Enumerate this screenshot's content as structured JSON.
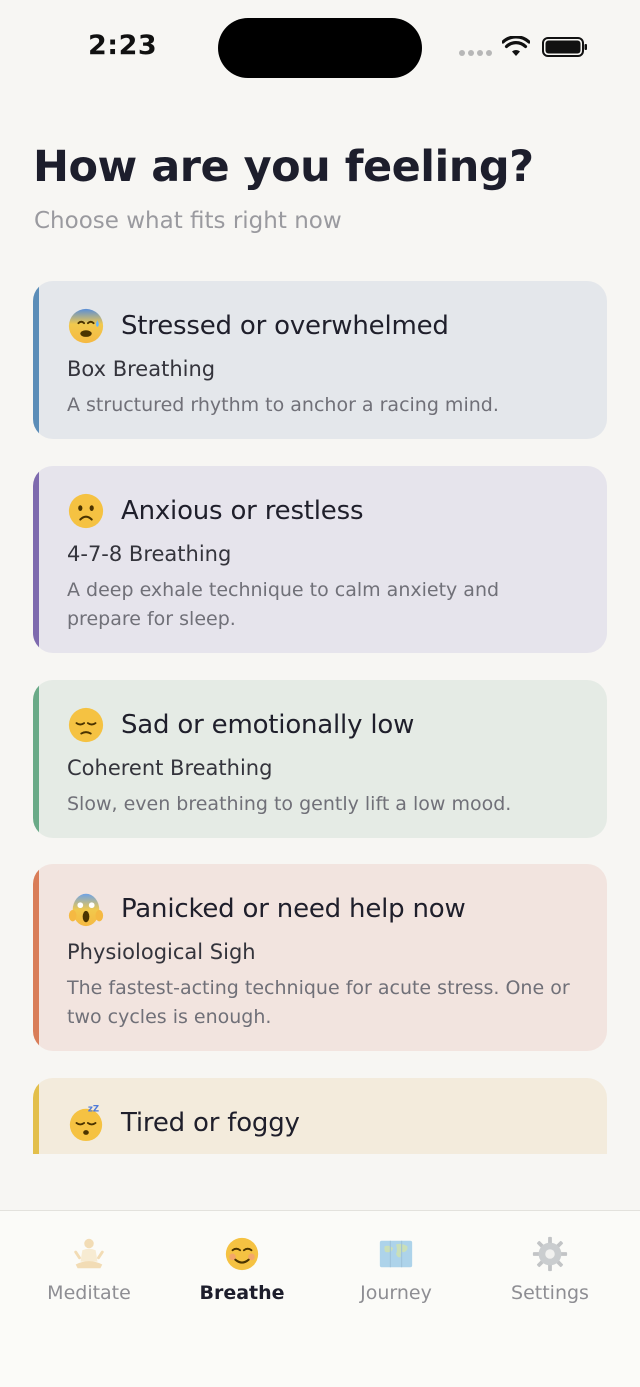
{
  "status_bar": {
    "time": "2:23"
  },
  "header": {
    "title": "How are you feeling?",
    "subtitle": "Choose what fits right now"
  },
  "moods": [
    {
      "emoji": "anxious-sweat-face-icon",
      "title": "Stressed or overwhelmed",
      "technique": "Box Breathing",
      "description": "A structured rhythm to anchor a racing mind.",
      "accent": "#5b8db8",
      "background": "#e4e7eb"
    },
    {
      "emoji": "worried-face-icon",
      "title": "Anxious or restless",
      "technique": "4-7-8 Breathing",
      "description": "A deep exhale technique to calm anxiety and prepare for sleep.",
      "accent": "#7e6aae",
      "background": "#e6e4ec"
    },
    {
      "emoji": "pensive-face-icon",
      "title": "Sad or emotionally low",
      "technique": "Coherent Breathing",
      "description": "Slow, even breathing to gently lift a low mood.",
      "accent": "#6aaa87",
      "background": "#e5ebe5"
    },
    {
      "emoji": "screaming-face-icon",
      "title": "Panicked or need help now",
      "technique": "Physiological Sigh",
      "description": "The fastest-acting technique for acute stress. One or two cycles is enough.",
      "accent": "#d97d58",
      "background": "#f2e4df"
    },
    {
      "emoji": "sleeping-face-icon",
      "title": "Tired or foggy",
      "technique": "",
      "description": "",
      "accent": "#e3bf4a",
      "background": "#f3ebdc"
    }
  ],
  "tab_bar": {
    "tabs": [
      {
        "label": "Meditate",
        "icon": "person-meditating-icon",
        "active": false
      },
      {
        "label": "Breathe",
        "icon": "smiling-face-icon",
        "active": true
      },
      {
        "label": "Journey",
        "icon": "world-map-icon",
        "active": false
      },
      {
        "label": "Settings",
        "icon": "gear-icon",
        "active": false
      }
    ]
  }
}
